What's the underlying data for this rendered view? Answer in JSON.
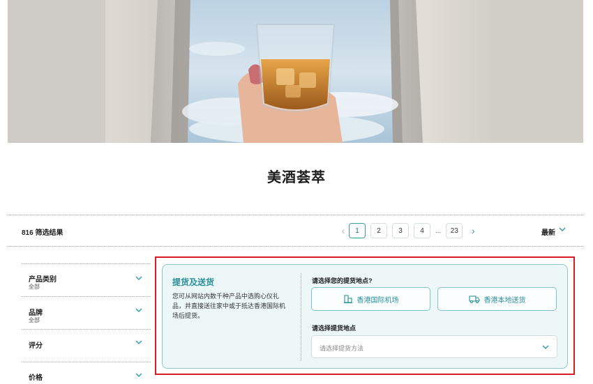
{
  "page": {
    "title": "美酒荟萃"
  },
  "results": {
    "count_label": "816 筛选结果"
  },
  "pagination": {
    "prev_icon": "chevron-left-icon",
    "pages": [
      "1",
      "2",
      "3",
      "4"
    ],
    "active_page": "1",
    "ellipsis": "...",
    "last_page": "23",
    "next_icon": "chevron-right-icon"
  },
  "sort": {
    "label": "最新"
  },
  "filters": [
    {
      "label": "产品类别",
      "sub": "全部"
    },
    {
      "label": "品牌",
      "sub": "全部"
    },
    {
      "label": "评分",
      "sub": ""
    },
    {
      "label": "价格",
      "sub": ""
    }
  ],
  "pickup": {
    "title": "提货及送货",
    "description": "您可从网站内数千种产品中选购心仪礼品，并直接送往家中或于抵达香港国际机场后提货。",
    "question_location": "请选择您的提货地点?",
    "option_airport": "香港国际机场",
    "option_local": "香港本地送货",
    "question_method": "请选择提货地点",
    "method_placeholder": "请选择提货方法"
  },
  "colors": {
    "accent": "#2a8f9c",
    "highlight_border": "#d81a23",
    "card_bg": "#edf7f7"
  }
}
